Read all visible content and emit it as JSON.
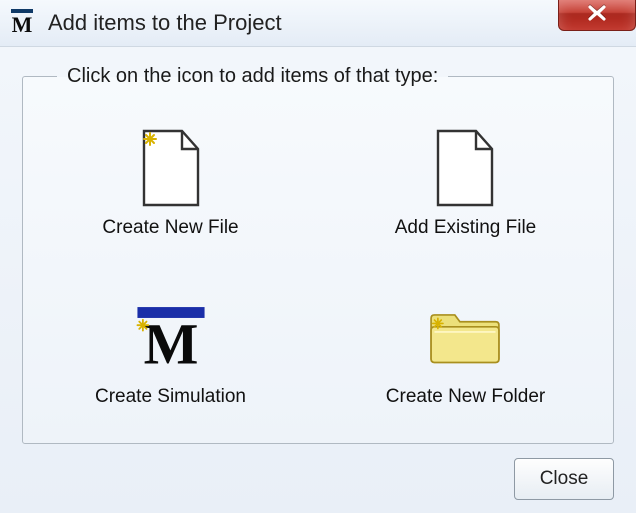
{
  "window": {
    "title": "Add items to the Project"
  },
  "group": {
    "legend": "Click on the icon to add items of that type:"
  },
  "items": {
    "create_new_file": "Create New File",
    "add_existing_file": "Add Existing File",
    "create_simulation": "Create Simulation",
    "create_new_folder": "Create New Folder"
  },
  "buttons": {
    "close": "Close"
  }
}
